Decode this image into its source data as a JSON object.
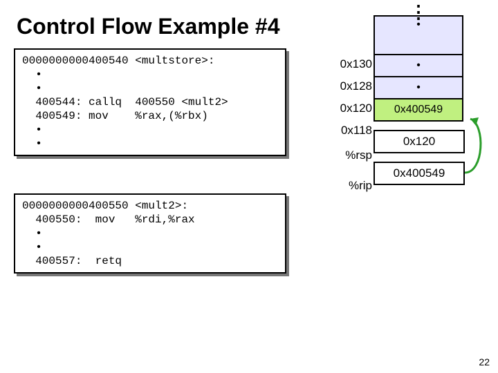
{
  "title": "Control Flow Example #4",
  "code1": {
    "l1": "0000000000400540 <multstore>:",
    "l2": "  •",
    "l3": "  •",
    "l4": "  400544: callq  400550 <mult2>",
    "l5": "  400549: mov    %rax,(%rbx)",
    "l6": "  •",
    "l7": "  •"
  },
  "code2": {
    "l1": "0000000000400550 <mult2>:",
    "l2": "  400550:  mov   %rdi,%rax",
    "l3": "  •",
    "l4": "  •",
    "l5": "  400557:  retq"
  },
  "stack": {
    "labels": {
      "a": "0x130",
      "b": "0x128",
      "c": "0x120",
      "d": "0x118",
      "rsp": "%rsp",
      "rip": "%rip"
    },
    "cells": {
      "a": "•",
      "b": "•",
      "c": "•",
      "d": "0x400549"
    },
    "rsp_val": "0x120",
    "rip_val": "0x400549"
  },
  "pagenum": "22"
}
